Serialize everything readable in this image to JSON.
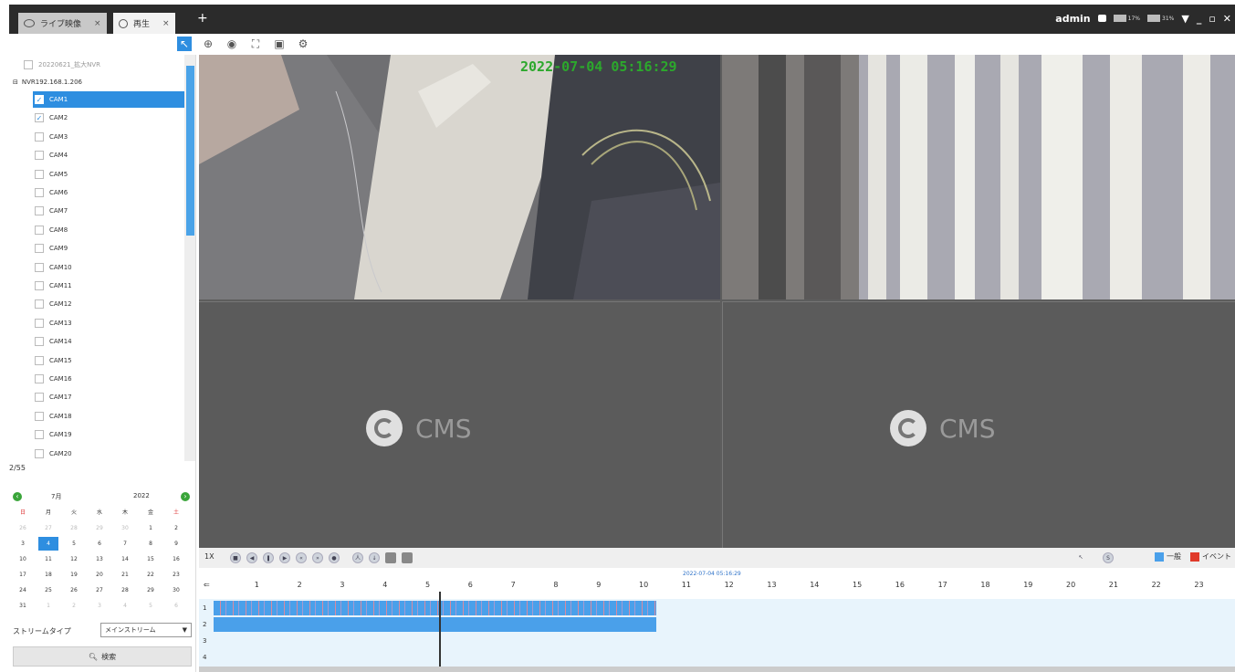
{
  "tabs": [
    {
      "label": "ライブ映像",
      "active": false
    },
    {
      "label": "再生",
      "active": true
    }
  ],
  "tab_add": "+",
  "header": {
    "user": "admin",
    "cpu_label": "17%",
    "mem_label": "31%",
    "window_controls": [
      "menu",
      "minimize",
      "restore",
      "close"
    ]
  },
  "toolbar": [
    "select-icon",
    "zoom-icon",
    "eye-icon",
    "fullscreen-icon",
    "snapshot-icon",
    "settings-icon"
  ],
  "tree": {
    "root": "20220621_拡大NVR",
    "nvr": "NVR192.168.1.206",
    "cameras": [
      {
        "label": "CAM1",
        "checked": true,
        "selected": true
      },
      {
        "label": "CAM2",
        "checked": true,
        "selected": false
      },
      {
        "label": "CAM3",
        "checked": false
      },
      {
        "label": "CAM4",
        "checked": false
      },
      {
        "label": "CAM5",
        "checked": false
      },
      {
        "label": "CAM6",
        "checked": false
      },
      {
        "label": "CAM7",
        "checked": false
      },
      {
        "label": "CAM8",
        "checked": false
      },
      {
        "label": "CAM9",
        "checked": false
      },
      {
        "label": "CAM10",
        "checked": false
      },
      {
        "label": "CAM11",
        "checked": false
      },
      {
        "label": "CAM12",
        "checked": false
      },
      {
        "label": "CAM13",
        "checked": false
      },
      {
        "label": "CAM14",
        "checked": false
      },
      {
        "label": "CAM15",
        "checked": false
      },
      {
        "label": "CAM16",
        "checked": false
      },
      {
        "label": "CAM17",
        "checked": false
      },
      {
        "label": "CAM18",
        "checked": false
      },
      {
        "label": "CAM19",
        "checked": false
      },
      {
        "label": "CAM20",
        "checked": false
      }
    ],
    "count": "2/55"
  },
  "calendar": {
    "month": "7月",
    "year": "2022",
    "weekdays": [
      "日",
      "月",
      "火",
      "水",
      "木",
      "金",
      "土"
    ],
    "weeks": [
      [
        "26",
        "27",
        "28",
        "29",
        "30",
        "1",
        "2"
      ],
      [
        "3",
        "4",
        "5",
        "6",
        "7",
        "8",
        "9"
      ],
      [
        "10",
        "11",
        "12",
        "13",
        "14",
        "15",
        "16"
      ],
      [
        "17",
        "18",
        "19",
        "20",
        "21",
        "22",
        "23"
      ],
      [
        "24",
        "25",
        "26",
        "27",
        "28",
        "29",
        "30"
      ],
      [
        "31",
        "1",
        "2",
        "3",
        "4",
        "5",
        "6"
      ]
    ],
    "selected_day": "4"
  },
  "stream": {
    "label": "ストリームタイプ",
    "value": "メインストリーム"
  },
  "search_button": "検索",
  "video": {
    "timestamp": "2022-07-04 05:16:29",
    "placeholder": "CMS"
  },
  "playback": {
    "speed": "1X",
    "legend": [
      {
        "label": "一般",
        "color": "#4aa0ea"
      },
      {
        "label": "イベント",
        "color": "#e03a2a"
      }
    ]
  },
  "timeline": {
    "date_label": "2022-07-04 05:16:29",
    "hours": [
      "1",
      "2",
      "3",
      "4",
      "5",
      "6",
      "7",
      "8",
      "9",
      "10",
      "11",
      "12",
      "13",
      "14",
      "15",
      "16",
      "17",
      "18",
      "19",
      "20",
      "21",
      "22",
      "23"
    ],
    "tracks": [
      "1",
      "2",
      "3",
      "4"
    ],
    "recorded_until_hour": 10.4,
    "cursor_hour": 5.27
  }
}
